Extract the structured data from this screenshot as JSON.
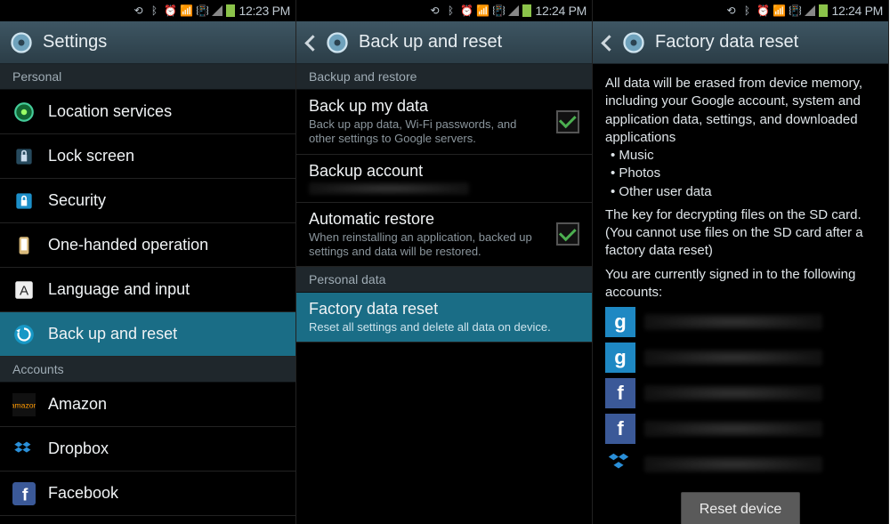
{
  "screen1": {
    "status": {
      "time": "12:23 PM"
    },
    "header": {
      "title": "Settings"
    },
    "sections": {
      "personal": {
        "label": "Personal",
        "items": [
          {
            "label": "Location services",
            "icon": "location-icon"
          },
          {
            "label": "Lock screen",
            "icon": "lock-icon"
          },
          {
            "label": "Security",
            "icon": "security-icon"
          },
          {
            "label": "One-handed operation",
            "icon": "one-hand-icon"
          },
          {
            "label": "Language and input",
            "icon": "language-icon"
          },
          {
            "label": "Back up and reset",
            "icon": "backup-icon",
            "selected": true
          }
        ]
      },
      "accounts": {
        "label": "Accounts",
        "items": [
          {
            "label": "Amazon",
            "icon": "amazon-icon"
          },
          {
            "label": "Dropbox",
            "icon": "dropbox-icon"
          },
          {
            "label": "Facebook",
            "icon": "facebook-icon"
          }
        ]
      }
    }
  },
  "screen2": {
    "status": {
      "time": "12:24 PM"
    },
    "header": {
      "title": "Back up and reset"
    },
    "sections": {
      "backup": {
        "label": "Backup and restore",
        "items": [
          {
            "label": "Back up my data",
            "sub": "Back up app data, Wi-Fi passwords, and other settings to Google servers.",
            "checked": true
          },
          {
            "label": "Backup account",
            "sub": ""
          },
          {
            "label": "Automatic restore",
            "sub": "When reinstalling an application, backed up settings and data will be restored.",
            "checked": true
          }
        ]
      },
      "personaldata": {
        "label": "Personal data",
        "items": [
          {
            "label": "Factory data reset",
            "sub": "Reset all settings and delete all data on device.",
            "selected": true
          }
        ]
      }
    }
  },
  "screen3": {
    "status": {
      "time": "12:24 PM"
    },
    "header": {
      "title": "Factory data reset"
    },
    "body": {
      "intro": "All data will be erased from device memory, including your Google account, system and application data, settings, and downloaded applications",
      "bullets": [
        "Music",
        "Photos",
        "Other user data"
      ],
      "sdkey": "The key for decrypting files on the SD card. (You cannot use files on the SD card after a factory data reset)",
      "signed_in": "You are currently signed in to the following accounts:",
      "accounts": [
        {
          "type": "google"
        },
        {
          "type": "google"
        },
        {
          "type": "facebook"
        },
        {
          "type": "facebook"
        },
        {
          "type": "dropbox"
        }
      ],
      "button": "Reset device"
    }
  }
}
